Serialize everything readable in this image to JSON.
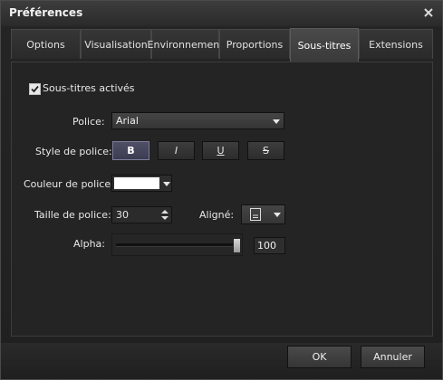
{
  "window": {
    "title": "Préférences",
    "close_icon": "close-icon"
  },
  "tabs": [
    {
      "label": "Options",
      "active": false
    },
    {
      "label": "Visualisation",
      "active": false
    },
    {
      "label": "Environnement",
      "active": false
    },
    {
      "label": "Proportions",
      "active": false
    },
    {
      "label": "Sous-titres",
      "active": true
    },
    {
      "label": "Extensions",
      "active": false
    }
  ],
  "subtitles": {
    "enabled_label": "Sous-titres activés",
    "enabled": true,
    "font_label": "Police:",
    "font_value": "Arial",
    "style_label": "Style de police:",
    "style_buttons": [
      "B",
      "I",
      "U",
      "S"
    ],
    "color_label": "Couleur de police:",
    "color_value": "#ffffff",
    "size_label": "Taille de police:",
    "size_value": "30",
    "align_label": "Aligné:",
    "align_icon": "align-bottom-icon",
    "alpha_label": "Alpha:",
    "alpha_value": "100"
  },
  "footer": {
    "ok_label": "OK",
    "cancel_label": "Annuler"
  }
}
